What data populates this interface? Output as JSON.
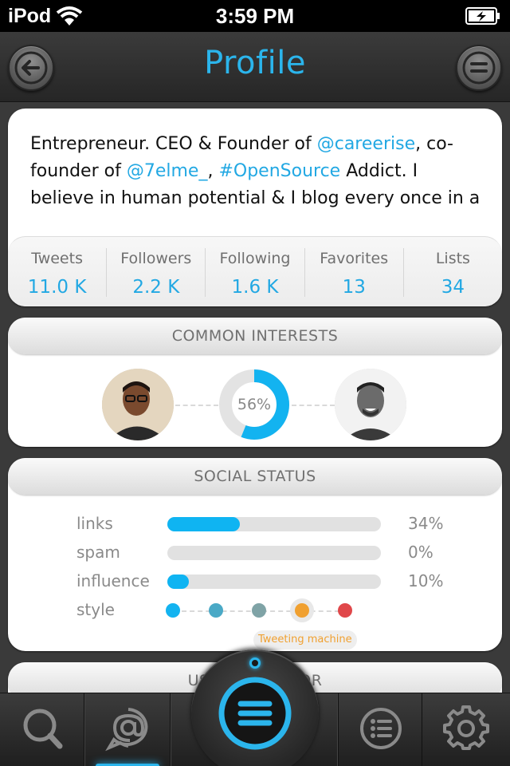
{
  "status_bar": {
    "carrier": "iPod",
    "time": "3:59 PM"
  },
  "nav": {
    "title": "Profile",
    "back_icon": "back-arrow-icon",
    "menu_icon": "menu-icon"
  },
  "bio": {
    "parts": [
      {
        "text": "Entrepreneur. CEO & Founder of ",
        "link": false
      },
      {
        "text": "@careerise",
        "link": true
      },
      {
        "text": ", co-founder of ",
        "link": false
      },
      {
        "text": "@7elme_",
        "link": true
      },
      {
        "text": ", ",
        "link": false
      },
      {
        "text": "#OpenSource",
        "link": true
      },
      {
        "text": " Addict. I believe in human potential & I blog every once in a",
        "link": false
      }
    ]
  },
  "stats": [
    {
      "label": "Tweets",
      "value": "11.0 K"
    },
    {
      "label": "Followers",
      "value": "2.2 K"
    },
    {
      "label": "Following",
      "value": "1.6 K"
    },
    {
      "label": "Favorites",
      "value": "13"
    },
    {
      "label": "Lists",
      "value": "34"
    }
  ],
  "common_interests": {
    "header": "COMMON INTERESTS",
    "percent_label": "56%",
    "percent_value": 0.56
  },
  "social_status": {
    "header": "SOCIAL STATUS",
    "metrics": [
      {
        "label": "links",
        "pct_label": "34%",
        "value": 0.34
      },
      {
        "label": "spam",
        "pct_label": "0%",
        "value": 0.0
      },
      {
        "label": "influence",
        "pct_label": "10%",
        "value": 0.1
      }
    ],
    "style_label": "style",
    "style_colors": [
      "#13b3f0",
      "#4aa9c6",
      "#7fa3a6",
      "#f0a030",
      "#e0474a"
    ],
    "style_selected_index": 3,
    "style_selected_name": "Tweeting machine"
  },
  "user_section": {
    "header": "USER INDICATOR"
  },
  "colors": {
    "accent": "#2bb5ec",
    "link": "#22a8e3",
    "bar_fill": "#0fb4f2"
  },
  "tabbar": {
    "tabs": [
      "search-icon",
      "mention-icon",
      "home-menu-icon",
      "list-icon",
      "gear-icon"
    ]
  }
}
